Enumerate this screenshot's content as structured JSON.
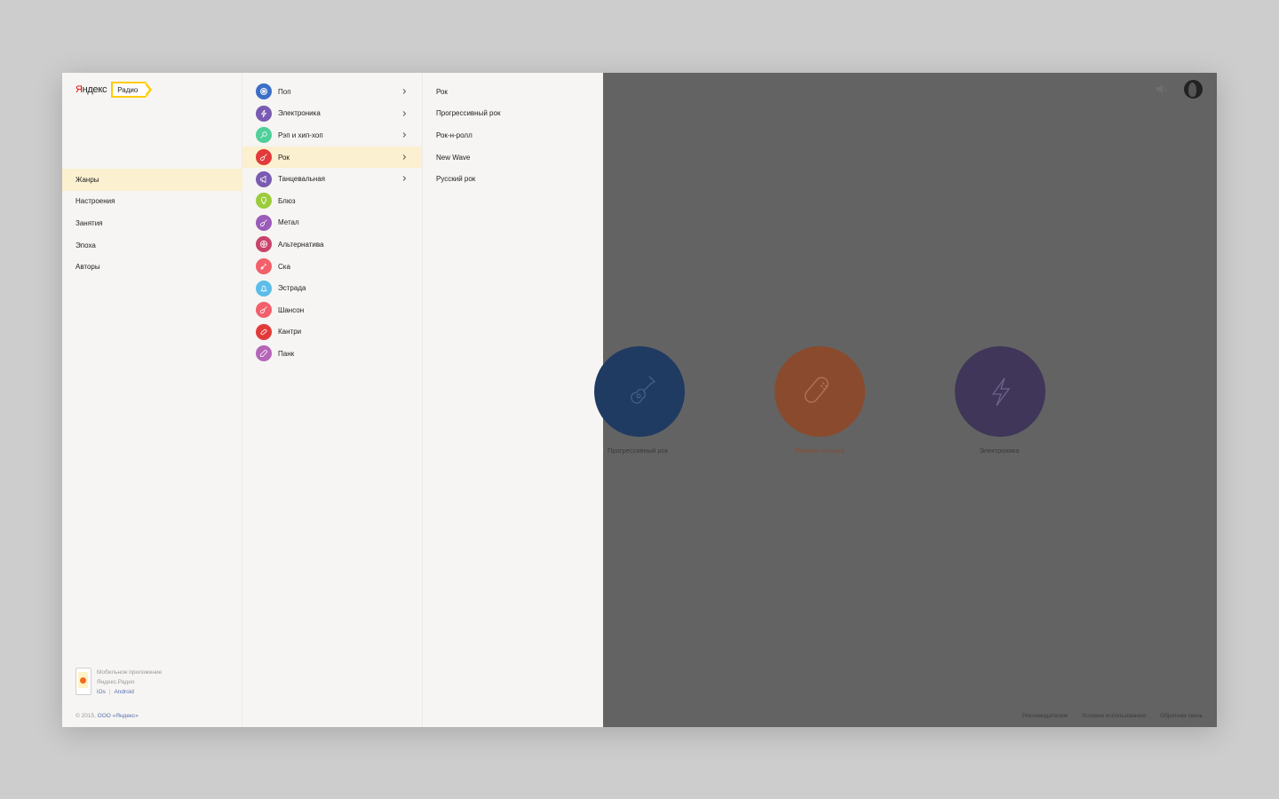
{
  "logo": {
    "brand_first": "Я",
    "brand_rest": "ндекс",
    "badge": "Радио"
  },
  "nav": {
    "items": [
      {
        "label": "Жанры",
        "active": true
      },
      {
        "label": "Настроения",
        "active": false
      },
      {
        "label": "Занятия",
        "active": false
      },
      {
        "label": "Эпоха",
        "active": false
      },
      {
        "label": "Авторы",
        "active": false
      }
    ]
  },
  "promo": {
    "line1": "Мобильное приложение",
    "line2": "Яндекс.Радио",
    "ios": "iOs",
    "separator": "|",
    "android": "Android"
  },
  "copyright": {
    "prefix": "© 2015, ",
    "company": "ООО «Яндекс»"
  },
  "genres": [
    {
      "label": "Поп",
      "color": "#3b6fc7",
      "icon": "disco-ball-icon",
      "has_children": true,
      "active": false
    },
    {
      "label": "Электроника",
      "color": "#7a5bb3",
      "icon": "lightning-icon",
      "has_children": true,
      "active": false
    },
    {
      "label": "Рэп и хип-хоп",
      "color": "#4fcf9a",
      "icon": "microphone-icon",
      "has_children": true,
      "active": false
    },
    {
      "label": "Рок",
      "color": "#e23a3a",
      "icon": "guitar-icon",
      "has_children": true,
      "active": true
    },
    {
      "label": "Танцевальная",
      "color": "#7a5bb3",
      "icon": "megaphone-icon",
      "has_children": true,
      "active": false
    },
    {
      "label": "Блюз",
      "color": "#9ccc3c",
      "icon": "bulb-icon",
      "has_children": false,
      "active": false
    },
    {
      "label": "Метал",
      "color": "#9b5bb8",
      "icon": "guitar-icon",
      "has_children": false,
      "active": false
    },
    {
      "label": "Альтернатива",
      "color": "#c9436b",
      "icon": "flower-icon",
      "has_children": false,
      "active": false
    },
    {
      "label": "Ска",
      "color": "#f2606b",
      "icon": "trumpet-icon",
      "has_children": false,
      "active": false
    },
    {
      "label": "Эстрада",
      "color": "#5bbde8",
      "icon": "bell-icon",
      "has_children": false,
      "active": false
    },
    {
      "label": "Шансон",
      "color": "#f2606b",
      "icon": "guitar-icon",
      "has_children": false,
      "active": false
    },
    {
      "label": "Кантри",
      "color": "#e23a3a",
      "icon": "harmonica-icon",
      "has_children": false,
      "active": false
    },
    {
      "label": "Панк",
      "color": "#b565b8",
      "icon": "pin-icon",
      "has_children": false,
      "active": false
    }
  ],
  "subgenres": [
    "Рок",
    "Прогрессивный рок",
    "Рок-н-ролл",
    "New Wave",
    "Русский рок"
  ],
  "stations": [
    {
      "label": "Прогрессивный рок",
      "color": "#1f3b62",
      "label_color": "#3a3a3a",
      "icon": "guitar-icon"
    },
    {
      "label": "Русская музыка",
      "color": "#8a4a2e",
      "label_color": "#8a4a2e",
      "icon": "harmonica-icon"
    },
    {
      "label": "Электроника",
      "color": "#3f3659",
      "label_color": "#3a3a3a",
      "icon": "lightning-icon"
    }
  ],
  "footer": {
    "links": [
      "Рекламодателям",
      "Условия использования",
      "Обратная связь"
    ]
  }
}
